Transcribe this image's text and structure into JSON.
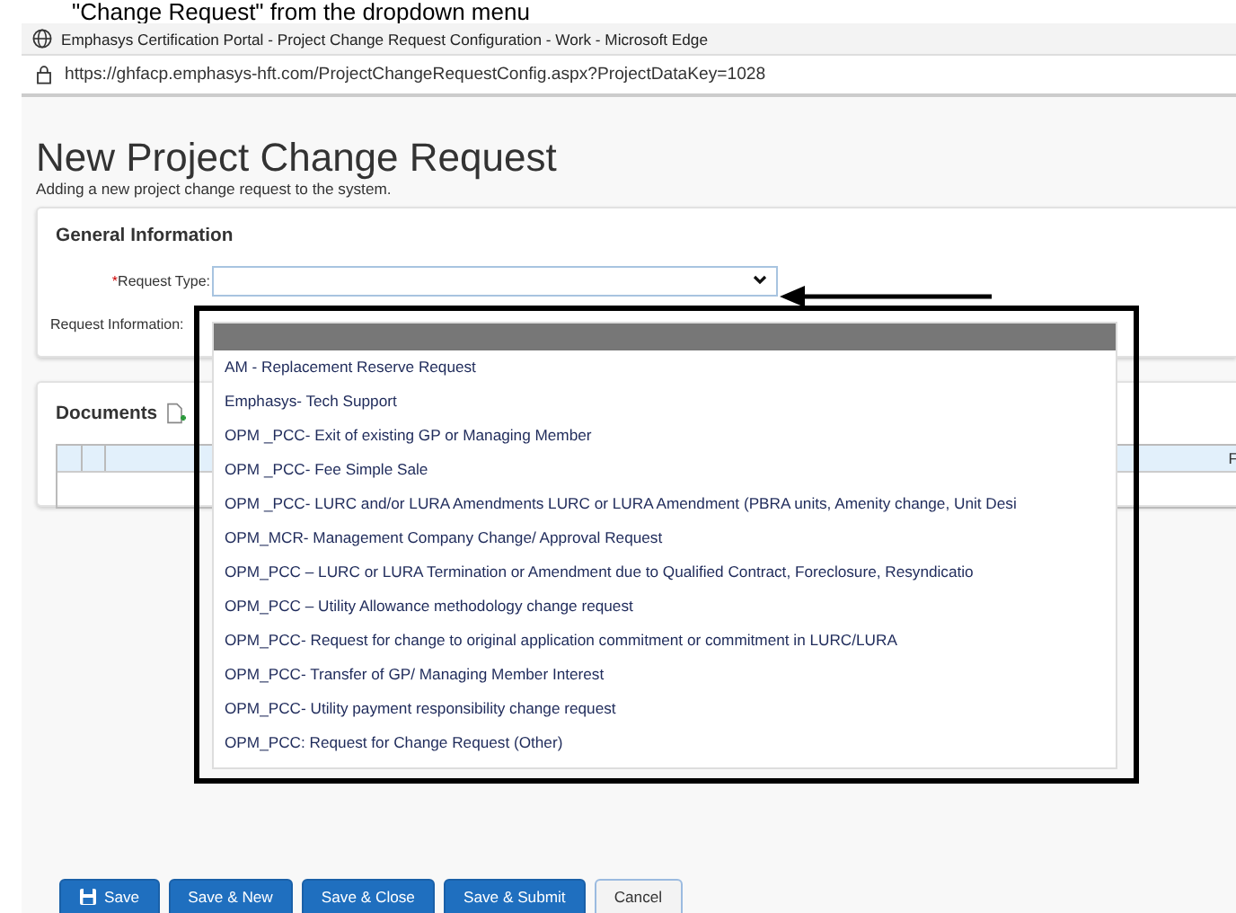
{
  "caption": "\"Change Request\" from the dropdown menu",
  "window": {
    "title": "Emphasys Certification Portal - Project Change Request Configuration - Work - Microsoft Edge",
    "url": "https://ghfacp.emphasys-hft.com/ProjectChangeRequestConfig.aspx?ProjectDataKey=1028"
  },
  "page": {
    "title": "New Project Change Request",
    "subtitle": "Adding a new project change request to the system."
  },
  "general_information": {
    "title": "General Information",
    "fields": [
      {
        "label": "Request Type:",
        "required": true,
        "required_mark": "*"
      },
      {
        "label": "Request Information:",
        "required": false
      }
    ]
  },
  "dropdown": {
    "blank_option_highlighted": true,
    "options": [
      {
        "label": "AM - Replacement Reserve Request",
        "selected": false
      },
      {
        "label": "Emphasys- Tech Support",
        "selected": false
      },
      {
        "label": "OPM _PCC- Exit of existing GP or Managing Member",
        "selected": false
      },
      {
        "label": "OPM _PCC- Fee Simple Sale",
        "selected": false
      },
      {
        "label": "OPM _PCC- LURC and/or LURA Amendments LURC or LURA Amendment (PBRA units, Amenity change, Unit Desi",
        "selected": false
      },
      {
        "label": "OPM_MCR- Management Company Change/ Approval Request",
        "selected": false
      },
      {
        "label": "OPM_PCC – LURC or LURA Termination or Amendment due to Qualified Contract, Foreclosure, Resyndicatio",
        "selected": false
      },
      {
        "label": "OPM_PCC – Utility Allowance methodology change request",
        "selected": false
      },
      {
        "label": "OPM_PCC- Request for change to original application commitment or commitment in LURC/LURA",
        "selected": false
      },
      {
        "label": "OPM_PCC- Transfer of GP/ Managing Member Interest",
        "selected": false
      },
      {
        "label": "OPM_PCC- Utility payment responsibility change request",
        "selected": false
      },
      {
        "label": "OPM_PCC: Request for Change Request (Other)",
        "selected": false
      }
    ]
  },
  "documents": {
    "title": "Documents",
    "table": {
      "column_4": "F"
    }
  },
  "buttons": [
    {
      "label": "Save",
      "kind": "primary",
      "icon": true
    },
    {
      "label": "Save & New",
      "kind": "primary",
      "icon": false
    },
    {
      "label": "Save & Close",
      "kind": "primary",
      "icon": false
    },
    {
      "label": "Save & Submit",
      "kind": "primary",
      "icon": false
    },
    {
      "label": "Cancel",
      "kind": "secondary",
      "icon": false
    }
  ]
}
